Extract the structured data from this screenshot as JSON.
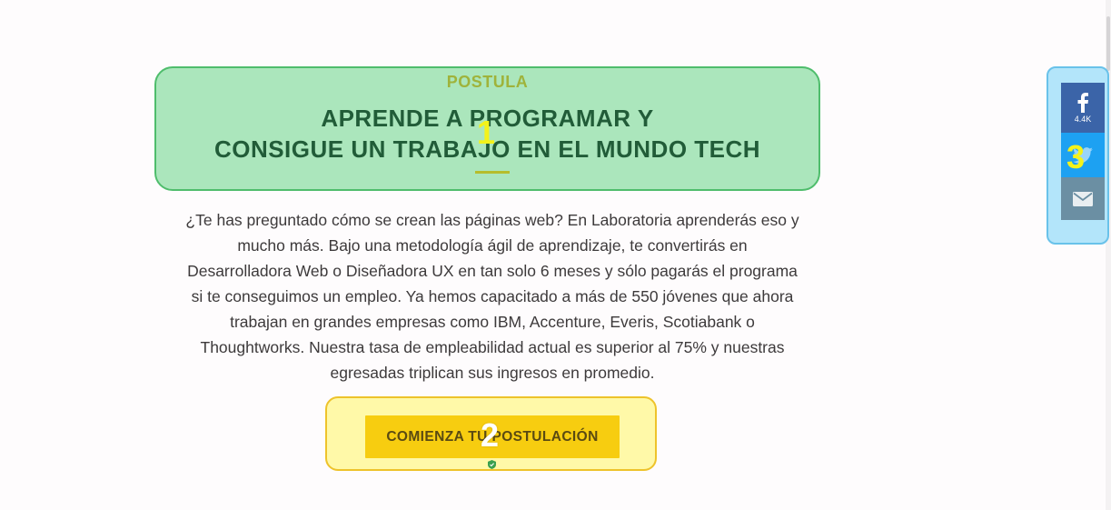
{
  "hero": {
    "kicker": "POSTULA",
    "headline_line1": "APRENDE A PROGRAMAR Y",
    "headline_line2": "CONSIGUE UN TRABAJO EN EL MUNDO TECH",
    "body_lines": [
      "¿Te has preguntado cómo se crean las páginas web? En Laboratoria aprenderás eso y",
      "mucho más. Bajo una metodología ágil de aprendizaje, te convertirás en",
      "Desarrolladora Web o Diseñadora UX en tan solo 6 meses y sólo pagarás el programa",
      "si te conseguimos un empleo. Ya hemos capacitado a más de 550 jóvenes que ahora",
      "trabajan en grandes empresas como IBM, Accenture, Everis, Scotiabank o",
      "Thoughtworks. Nuestra tasa de empleabilidad actual es superior al 75% y nuestras",
      "egresadas triplican sus ingresos en promedio."
    ],
    "cta_label": "COMIENZA TU POSTULACIÓN"
  },
  "share_bar": {
    "facebook_icon": "facebook-icon",
    "facebook_count": "4.4K",
    "twitter_icon": "twitter-icon",
    "email_icon": "email-icon"
  },
  "annotations": {
    "marker_1": "1",
    "marker_2": "2",
    "marker_3": "3"
  },
  "colors": {
    "page_background": "#fefcfd",
    "headline": "#215c38",
    "kicker": "#9fb33b",
    "cta_background": "#f7cd10",
    "facebook": "#3b64a8",
    "twitter": "#1da1f2",
    "email": "#6b8fa3"
  }
}
